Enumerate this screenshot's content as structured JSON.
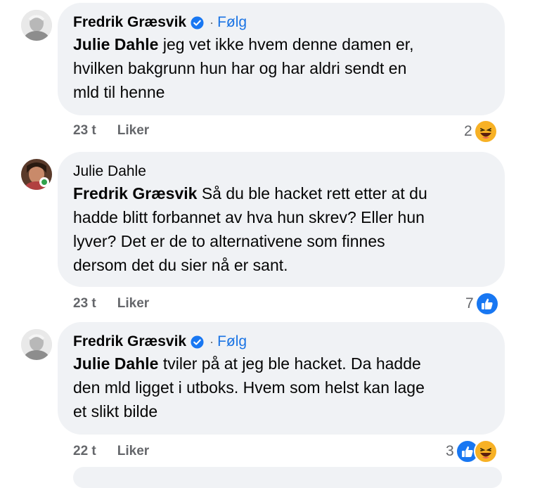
{
  "comments": [
    {
      "author": "Fredrik Græsvik",
      "verified": true,
      "follow_label": "Følg",
      "mention": "Julie Dahle",
      "text_lines": [
        "jeg vet ikke hvem denne damen er,",
        "hvilken bakgrunn hun har og har aldri sendt en",
        "mld til henne"
      ],
      "time": "23 t",
      "like_label": "Liker",
      "reaction_count": "2",
      "reactions": [
        "haha-icon"
      ]
    },
    {
      "author": "Julie Dahle",
      "verified": false,
      "online": true,
      "mention": "Fredrik Græsvik",
      "text_lines": [
        "Så du ble hacket rett etter at du",
        "hadde blitt forbannet av hva hun skrev? Eller hun",
        "lyver? Det er de to alternativene som finnes",
        "dersom det du sier nå er sant."
      ],
      "time": "23 t",
      "like_label": "Liker",
      "reaction_count": "7",
      "reactions": [
        "like-icon"
      ]
    },
    {
      "author": "Fredrik Græsvik",
      "verified": true,
      "follow_label": "Følg",
      "mention": "Julie Dahle",
      "text_lines": [
        "tviler på at jeg ble hacket. Da hadde",
        "den mld ligget i utboks. Hvem som helst kan lage",
        "et slikt bilde"
      ],
      "time": "22 t",
      "like_label": "Liker",
      "reaction_count": "3",
      "reactions": [
        "like-icon",
        "haha-icon"
      ]
    }
  ],
  "colors": {
    "bubble": "#f0f2f5",
    "follow": "#1b74e4",
    "meta": "#65676b",
    "like_reaction": "#1877f2",
    "haha_reaction": "#f7b125"
  }
}
